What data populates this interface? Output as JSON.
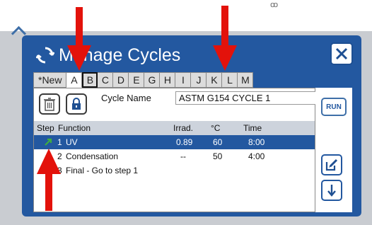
{
  "top_glyph": "ꝏ",
  "dialog": {
    "title": "Manage Cycles",
    "title_icon": "cycle-arrows-icon",
    "close_icon": "close-x-icon"
  },
  "tabs": [
    {
      "label": "*New",
      "active": false
    },
    {
      "label": "A",
      "active": true
    },
    {
      "label": "B",
      "active": false,
      "bordered": true
    },
    {
      "label": "C",
      "active": false
    },
    {
      "label": "D",
      "active": false
    },
    {
      "label": "E",
      "active": false
    },
    {
      "label": "G",
      "active": false
    },
    {
      "label": "H",
      "active": false
    },
    {
      "label": "I",
      "active": false
    },
    {
      "label": "J",
      "active": false
    },
    {
      "label": "K",
      "active": false
    },
    {
      "label": "L",
      "active": false
    },
    {
      "label": "M",
      "active": false
    }
  ],
  "editor": {
    "cycle_name_label": "Cycle Name",
    "cycle_name_value": "ASTM G154 CYCLE 1",
    "run_label": "RUN",
    "delete_icon": "trash-icon",
    "lock_icon": "lock-icon"
  },
  "table": {
    "headers": {
      "step": "Step",
      "function": "Function",
      "irrad": "Irrad.",
      "temp": "°C",
      "time": "Time"
    },
    "rows": [
      {
        "step": "1",
        "function": "UV",
        "irrad": "0.89",
        "temp": "60",
        "time": "8:00",
        "selected": true
      },
      {
        "step": "2",
        "function": "Condensation",
        "irrad": "--",
        "temp": "50",
        "time": "4:00",
        "selected": false
      },
      {
        "step": "3",
        "function": "Final - Go to step 1",
        "irrad": "",
        "temp": "",
        "time": "",
        "selected": false
      }
    ]
  },
  "side_buttons": {
    "edit_icon": "edit-icon",
    "down_icon": "arrow-down-icon"
  },
  "annotations": {
    "arrow_color": "#e3120b",
    "accent": "#2358a0"
  }
}
